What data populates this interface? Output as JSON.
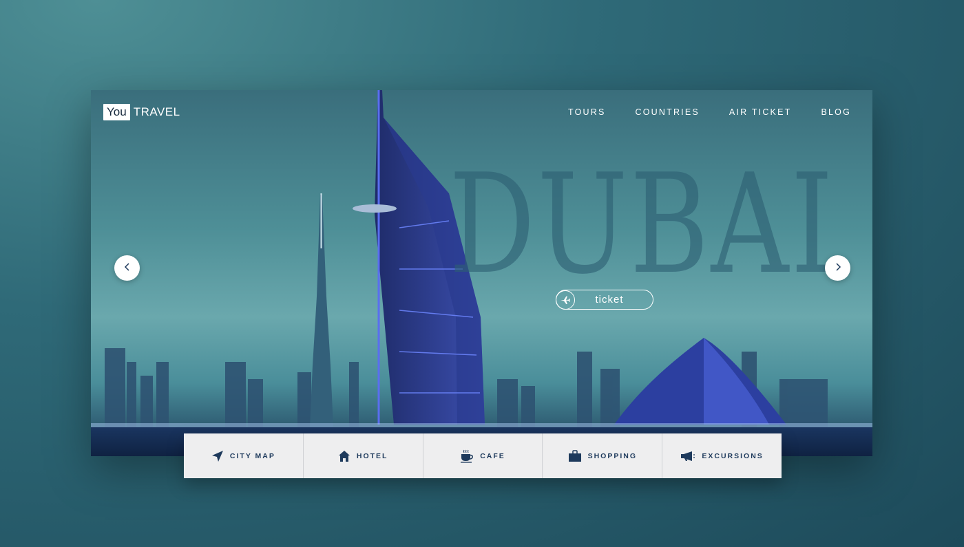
{
  "brand": {
    "logo_box": "You",
    "logo_text": "TRAVEL"
  },
  "nav": [
    {
      "label": "TOURS"
    },
    {
      "label": "COUNTRIES"
    },
    {
      "label": "AIR TICKET"
    },
    {
      "label": "BLOG"
    }
  ],
  "hero": {
    "title": "DUBAI",
    "ticket_label": "ticket",
    "ticket_icon": "airplane-icon",
    "prev_icon": "chevron-left-icon",
    "next_icon": "chevron-right-icon"
  },
  "categories": [
    {
      "label": "CITY MAP",
      "icon": "navigation-arrow-icon"
    },
    {
      "label": "HOTEL",
      "icon": "house-icon"
    },
    {
      "label": "CAFE",
      "icon": "coffee-cup-icon"
    },
    {
      "label": "SHOPPING",
      "icon": "shopping-bag-icon"
    },
    {
      "label": "EXCURSIONS",
      "icon": "megaphone-icon"
    }
  ],
  "colors": {
    "accent": "#1e3a5c",
    "bar_background": "#eeeeef",
    "hero_teal": "#4e8f97"
  }
}
